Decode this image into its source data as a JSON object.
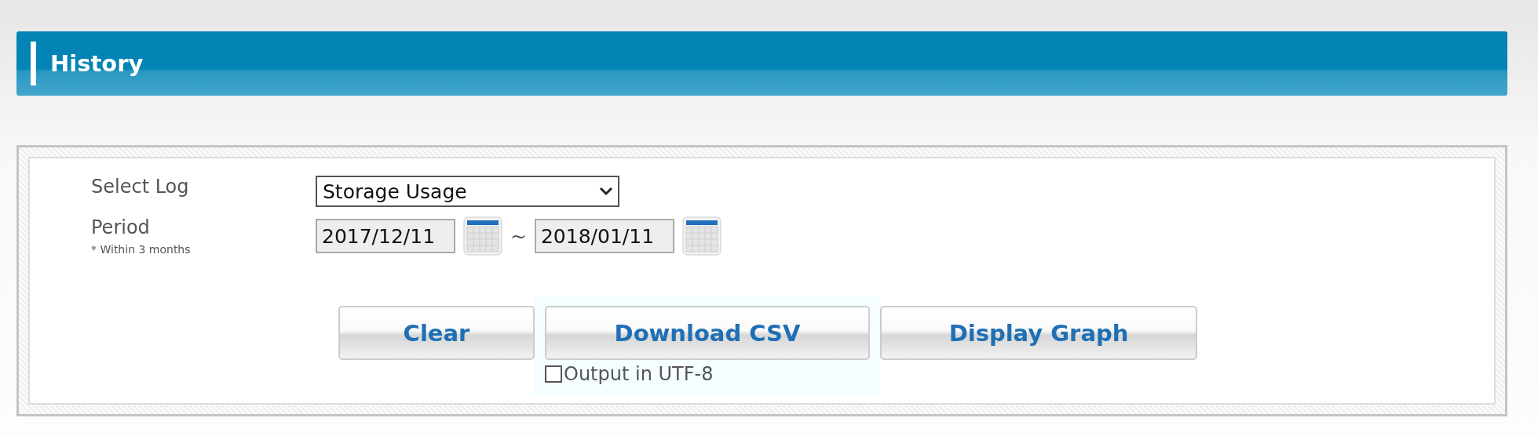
{
  "header": {
    "title": "History"
  },
  "form": {
    "select_log": {
      "label": "Select Log",
      "value": "Storage Usage"
    },
    "period": {
      "label": "Period",
      "note": "* Within 3 months",
      "from": "2017/12/11",
      "separator": "~",
      "to": "2018/01/11"
    }
  },
  "buttons": [
    {
      "label": "Clear",
      "kind": "plain"
    },
    {
      "label": "Download CSV",
      "kind": "download"
    },
    {
      "label": "Display Graph",
      "kind": "plain"
    }
  ],
  "utf8_option": {
    "label": "Output in UTF-8",
    "checked": false
  }
}
